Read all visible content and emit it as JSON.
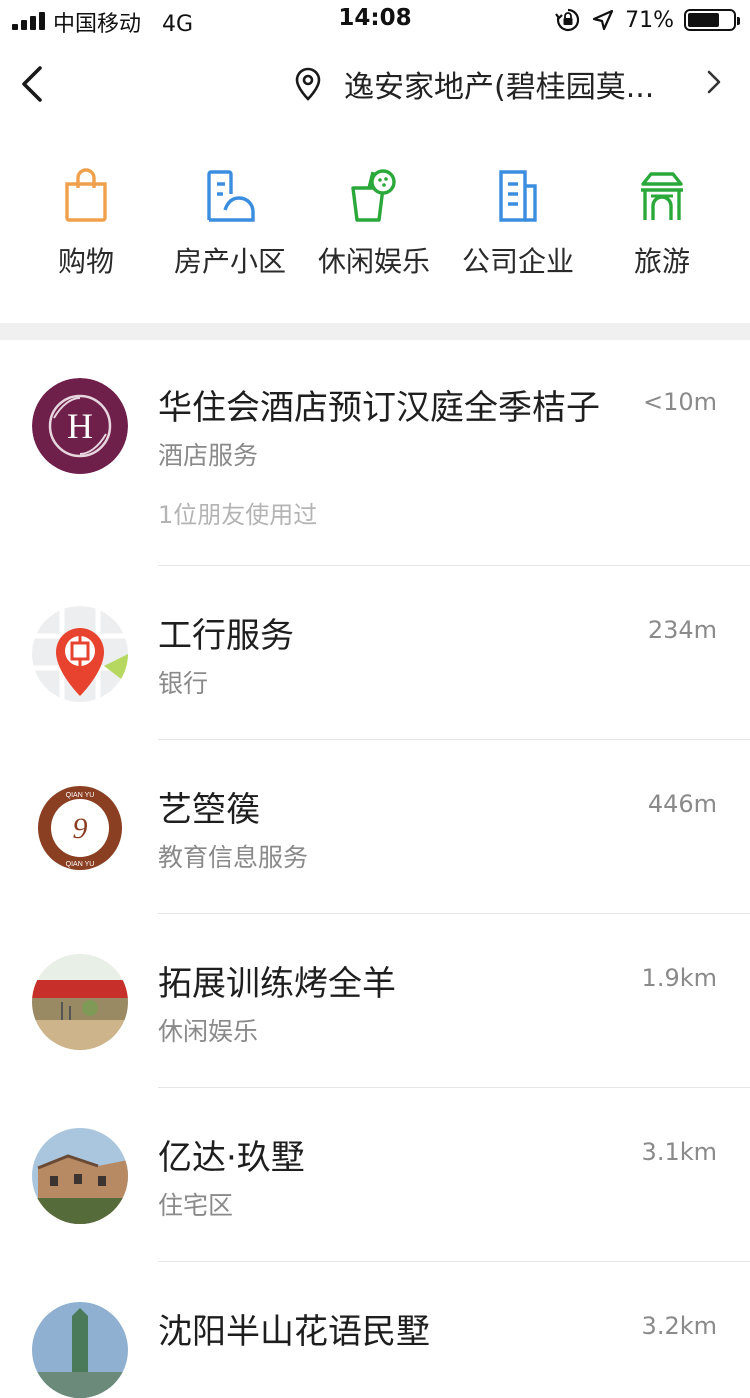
{
  "status_bar": {
    "carrier": "中国移动",
    "network": "4G",
    "time": "14:08",
    "battery": "71%",
    "battery_level": 0.71
  },
  "nav": {
    "location": "逸安家地产(碧桂园莫..."
  },
  "categories": [
    {
      "label": "购物",
      "icon": "shopping-bag-icon",
      "color": "#f0a04b"
    },
    {
      "label": "房产小区",
      "icon": "building-icon",
      "color": "#3b8de0"
    },
    {
      "label": "休闲娱乐",
      "icon": "drink-icon",
      "color": "#2aa83a"
    },
    {
      "label": "公司企业",
      "icon": "document-icon",
      "color": "#3b8de0"
    },
    {
      "label": "旅游",
      "icon": "gate-icon",
      "color": "#2aa83a"
    }
  ],
  "places": [
    {
      "title": "华住会酒店预订汉庭全季桔子",
      "subtitle": "酒店服务",
      "extra": "1位朋友使用过",
      "distance": "<10m",
      "avatar": "hotel-logo"
    },
    {
      "title": "工行服务",
      "subtitle": "银行",
      "extra": "",
      "distance": "234m",
      "avatar": "icbc-logo"
    },
    {
      "title": "艺箜篌",
      "subtitle": "教育信息服务",
      "extra": "",
      "distance": "446m",
      "avatar": "qianyu-logo"
    },
    {
      "title": "拓展训练烤全羊",
      "subtitle": "休闲娱乐",
      "extra": "",
      "distance": "1.9km",
      "avatar": "courtyard-photo"
    },
    {
      "title": "亿达·玖墅",
      "subtitle": "住宅区",
      "extra": "",
      "distance": "3.1km",
      "avatar": "villa-photo"
    },
    {
      "title": "沈阳半山花语民墅",
      "subtitle": "",
      "extra": "",
      "distance": "3.2km",
      "avatar": "tower-photo"
    }
  ]
}
